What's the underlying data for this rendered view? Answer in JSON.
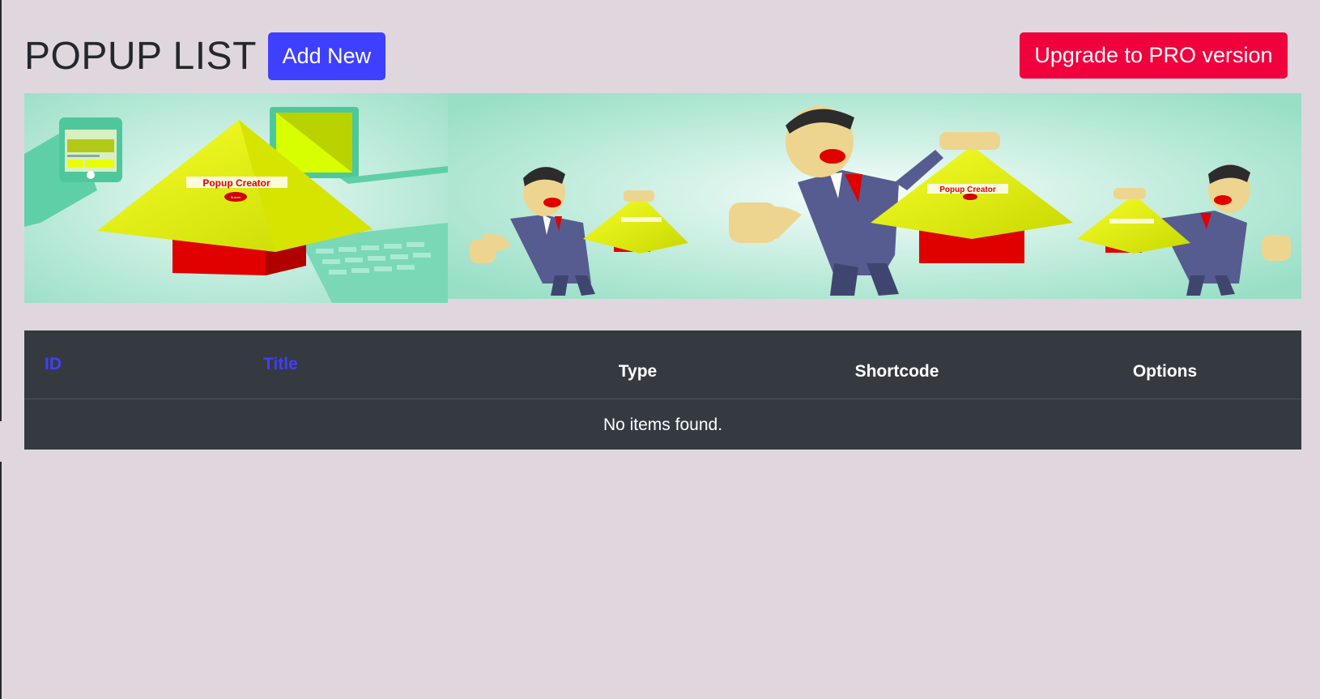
{
  "header": {
    "title": "POPUP LIST",
    "add_new_label": "Add New",
    "upgrade_label": "Upgrade to PRO version"
  },
  "banner": {
    "product_name": "Popup Creator",
    "submit_text": "Submit"
  },
  "table": {
    "columns": [
      "ID",
      "Title",
      "Type",
      "Shortcode",
      "Options"
    ],
    "empty_message": "No items found."
  },
  "colors": {
    "background": "#e0d7de",
    "add_new": "#3f3fff",
    "upgrade": "#f0003c",
    "table_bg": "#343a40",
    "sortable_link": "#3f3fff"
  }
}
